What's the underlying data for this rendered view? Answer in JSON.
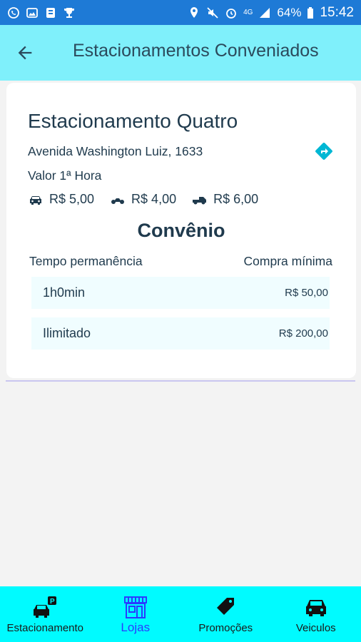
{
  "status_bar": {
    "battery": "64%",
    "time": "15:42",
    "network": "4G"
  },
  "header": {
    "title": "Estacionamentos Conveniados",
    "back_icon": "arrow-left-icon"
  },
  "parking": {
    "name": "Estacionamento Quatro",
    "address": "Avenida Washington Luiz, 1633",
    "first_hour_label": "Valor 1ª Hora",
    "prices": [
      {
        "icon": "car-icon",
        "value": "R$ 5,00"
      },
      {
        "icon": "motorcycle-icon",
        "value": "R$ 4,00"
      },
      {
        "icon": "pickup-truck-icon",
        "value": "R$ 6,00"
      }
    ]
  },
  "convenio": {
    "title": "Convênio",
    "col_tempo": "Tempo permanência",
    "col_compra": "Compra mínima",
    "rows": [
      {
        "tempo": "1h0min",
        "compra": "R$ 50,00"
      },
      {
        "tempo": "Ilimitado",
        "compra": "R$ 200,00"
      }
    ]
  },
  "bottom_nav": {
    "active": "Lojas",
    "items": [
      {
        "label": "Estacionamento",
        "icon": "parking-car-icon"
      },
      {
        "label": "Lojas",
        "icon": "store-icon"
      },
      {
        "label": "Promoções",
        "icon": "tag-icon"
      },
      {
        "label": "Veiculos",
        "icon": "car-icon"
      }
    ]
  },
  "colors": {
    "status_bar": "#1e7ad6",
    "app_bar": "#7ff0fb",
    "bottom_nav": "#00fbff",
    "accent": "#00b7d4",
    "active_nav": "#2a3bff"
  }
}
